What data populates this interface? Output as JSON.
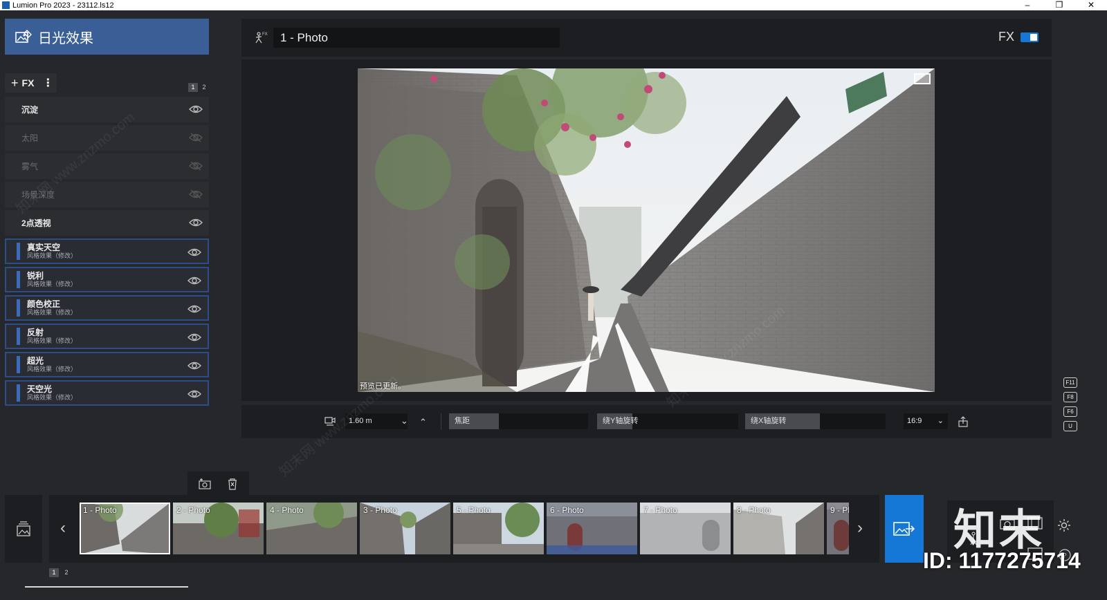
{
  "window": {
    "title": "Lumion Pro 2023 - 23112.ls12",
    "minimize": "–",
    "restore": "❐",
    "close": "✕"
  },
  "mode": {
    "title": "日光效果",
    "icon": "image-edit-icon"
  },
  "fx_toolbar": {
    "add_label": "FX",
    "plus": "+",
    "more": "⋮",
    "pages": [
      "1",
      "2"
    ],
    "active_page": "1"
  },
  "effects": [
    {
      "label": "沉淀",
      "visible": true,
      "style": false
    },
    {
      "label": "太阳",
      "visible": false,
      "style": false
    },
    {
      "label": "雾气",
      "visible": false,
      "style": false
    },
    {
      "label": "场景深度",
      "visible": false,
      "style": false
    },
    {
      "label": "2点透视",
      "visible": true,
      "style": false
    },
    {
      "label": "真实天空",
      "sub": "风格效果（修改）",
      "visible": true,
      "style": true
    },
    {
      "label": "锐利",
      "sub": "风格效果（修改）",
      "visible": true,
      "style": true
    },
    {
      "label": "颜色校正",
      "sub": "风格效果（修改）",
      "visible": true,
      "style": true
    },
    {
      "label": "反射",
      "sub": "风格效果（修改）",
      "visible": true,
      "style": true
    },
    {
      "label": "超光",
      "sub": "风格效果（修改）",
      "visible": true,
      "style": true
    },
    {
      "label": "天空光",
      "sub": "风格效果（修改）",
      "visible": true,
      "style": true
    }
  ],
  "topbar": {
    "photo_name": "1 - Photo",
    "fx_label": "FX",
    "fx_enabled": true
  },
  "viewport": {
    "status": "预览已更新。"
  },
  "camera": {
    "height": "1.60 m",
    "sliders": [
      {
        "label": "焦距",
        "value": 0.36
      },
      {
        "label": "绕Y轴旋转",
        "value": 0.25
      },
      {
        "label": "绕X轴旋转",
        "value": 0.53
      }
    ],
    "aspect": "16:9"
  },
  "fkeys": [
    "F11",
    "F8",
    "F6",
    "U"
  ],
  "filmstrip": {
    "thumbs": [
      "1 - Photo",
      "2 - Photo",
      "4 - Photo",
      "3 - Photo",
      "5 - Photo",
      "6 - Photo",
      "7 - Photo",
      "8 - Photo",
      "9 - Ph"
    ],
    "active": "1 - Photo",
    "pages": [
      "1",
      "2"
    ],
    "prev": "‹",
    "next": "›"
  },
  "watermark": {
    "logo": "知末",
    "id": "ID: 1177275714",
    "text": "知末网 www.znzmo.com"
  }
}
